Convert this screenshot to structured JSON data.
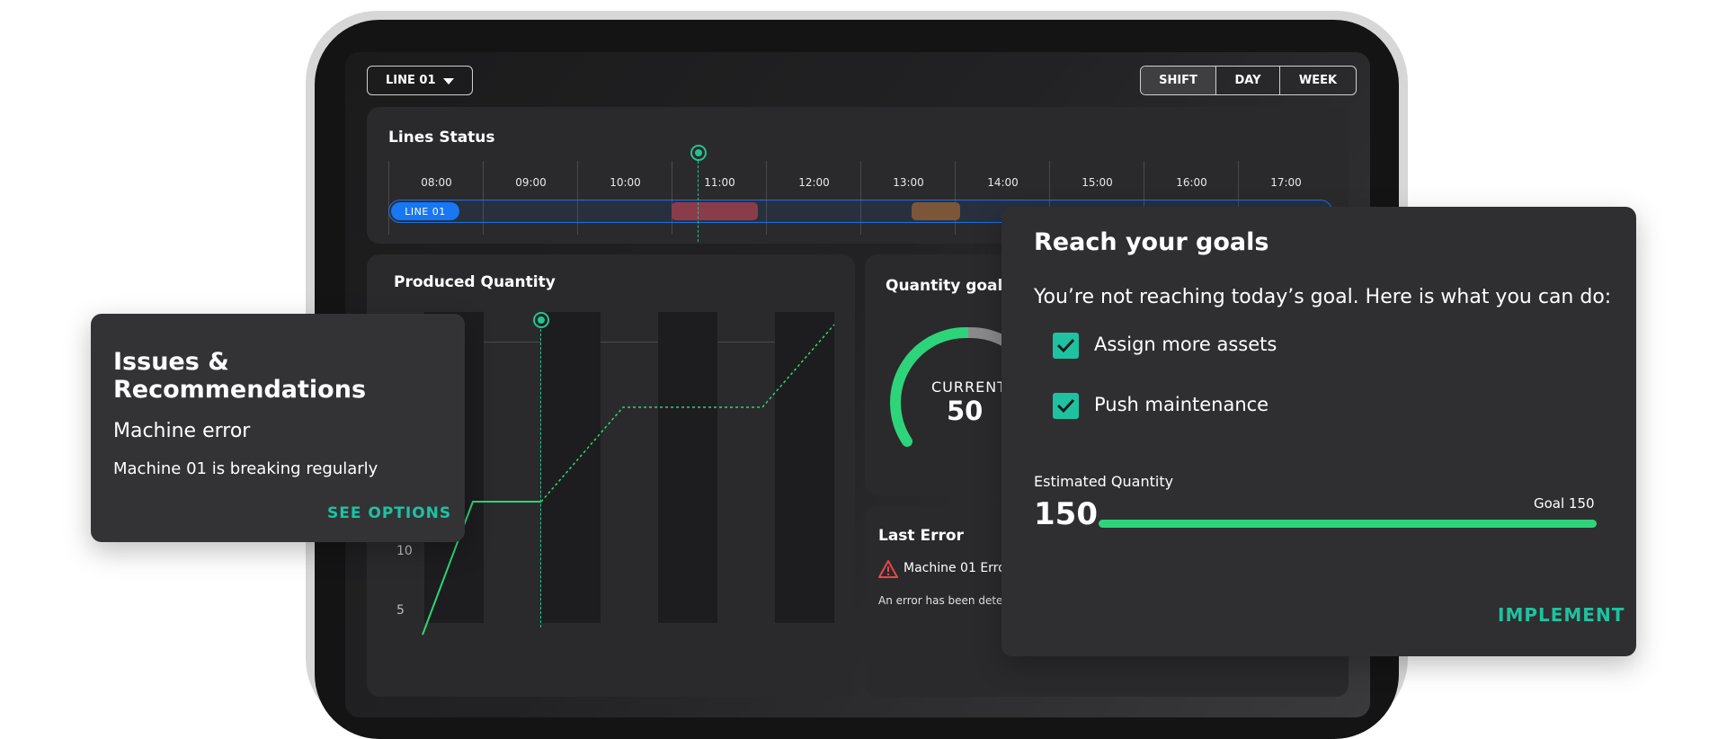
{
  "header": {
    "line_select_label": "LINE 01",
    "range_options": [
      "SHIFT",
      "DAY",
      "WEEK"
    ],
    "range_selected": "SHIFT"
  },
  "lines_status": {
    "title": "Lines Status",
    "hours": [
      "08:00",
      "09:00",
      "10:00",
      "11:00",
      "12:00",
      "13:00",
      "14:00",
      "15:00",
      "16:00",
      "17:00"
    ],
    "line_label": "LINE 01",
    "colors": {
      "line_accent": "#1877f2",
      "error_segment": "#8a3c4b",
      "warning_segment": "#7b5638",
      "marker": "#22c38e"
    }
  },
  "produced_quantity": {
    "title": "Produced Quantity",
    "y_ticks": [
      "10",
      "5"
    ]
  },
  "quantity_goals": {
    "title": "Quantity goals",
    "current_label": "CURRENT",
    "current_value": "50"
  },
  "last_error": {
    "title": "Last Error",
    "error_title": "Machine 01 Erro",
    "error_text": "An error has been dete"
  },
  "issues_card": {
    "title": "Issues & Recommendations",
    "issue_title": "Machine error",
    "issue_text": "Machine 01 is breaking regularly",
    "action_label": "SEE OPTIONS"
  },
  "goals_card": {
    "title": "Reach your goals",
    "subtitle": "You’re not reaching today’s goal. Here is what you can do:",
    "options": [
      {
        "label": "Assign more assets",
        "checked": true
      },
      {
        "label": "Push maintenance",
        "checked": true
      }
    ],
    "estimated_label": "Estimated Quantity",
    "estimated_value": "150",
    "goal_label": "Goal 150",
    "progress_fraction": 1.0,
    "action_label": "IMPLEMENT",
    "colors": {
      "accent": "#1fc2a0",
      "progress": "#2ed47a"
    }
  }
}
